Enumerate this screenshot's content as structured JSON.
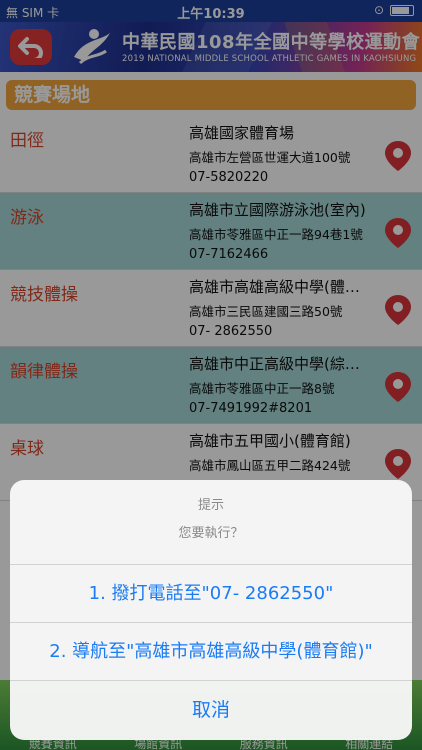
{
  "status_bar": {
    "carrier": "無 SIM 卡",
    "time": "上午10:39"
  },
  "header": {
    "title": "中華民國108年全國中等學校運動會",
    "subtitle": "2019 NATIONAL MIDDLE SCHOOL ATHLETIC GAMES IN KAOHSIUNG",
    "back_icon": "back-arrow-icon"
  },
  "section": {
    "label": "競賽場地"
  },
  "venues": [
    {
      "sport": "田徑",
      "venue": "高雄國家體育場",
      "address": "高雄市左營區世運大道100號",
      "phone": "07-5820220"
    },
    {
      "sport": "游泳",
      "venue": "高雄市立國際游泳池(室內)",
      "address": "高雄市苓雅區中正一路94巷1號",
      "phone": "07-7162466"
    },
    {
      "sport": "競技體操",
      "venue": "高雄市高雄高級中學(體育館)",
      "address": "高雄市三民區建國三路50號",
      "phone": "07- 2862550"
    },
    {
      "sport": "韻律體操",
      "venue": "高雄市中正高級中學(綜合館)",
      "address": "高雄市苓雅區中正一路8號",
      "phone": "07-7491992#8201"
    },
    {
      "sport": "桌球",
      "venue": "高雄市五甲國小(體育館)",
      "address": "高雄市鳳山區五甲二路424號",
      "phone": ""
    }
  ],
  "tabbar": {
    "tabs": [
      "競賽資訊",
      "場館資訊",
      "服務資訊",
      "相關連結"
    ]
  },
  "action_sheet": {
    "title": "提示",
    "message": "您要執行？",
    "call": "1. 撥打電話至\"07- 2862550\"",
    "navigate": "2. 導航至\"高雄市高雄高級中學(體育館)\"",
    "cancel": "取消"
  },
  "colors": {
    "accent": "#1a7cf5",
    "sport_text": "#d6452a",
    "section": "#f1a33c",
    "row_alt": "#a7d8d8",
    "pin": "#d9343a"
  }
}
